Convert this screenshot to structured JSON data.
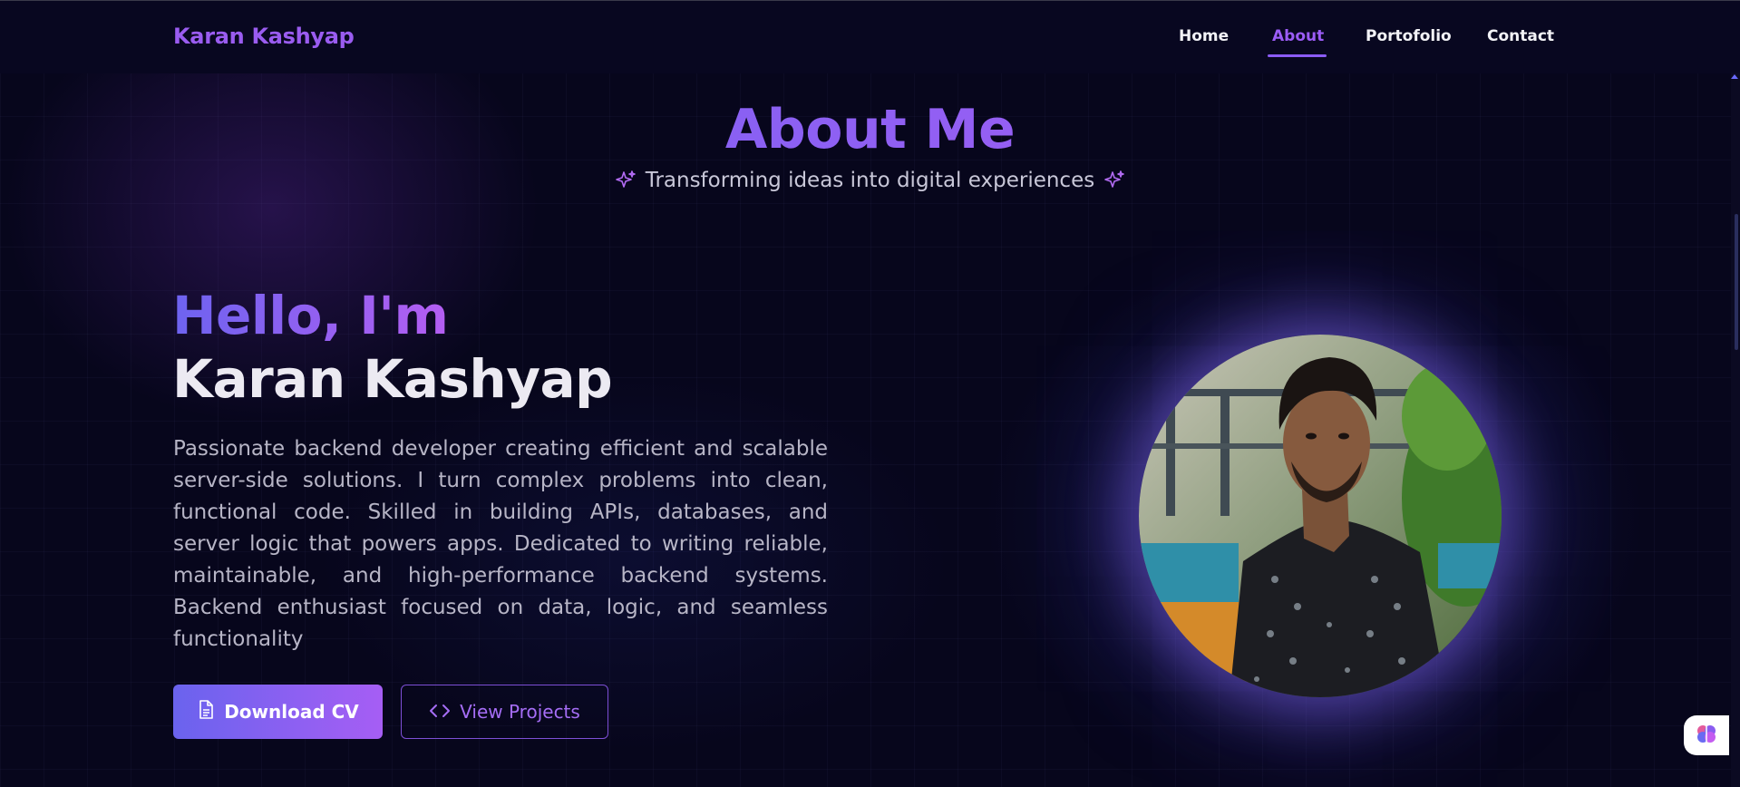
{
  "brand": {
    "name": "Karan Kashyap"
  },
  "nav": {
    "items": [
      {
        "label": "Home"
      },
      {
        "label": "About"
      },
      {
        "label": "Portofolio"
      },
      {
        "label": "Contact"
      }
    ],
    "active": "About"
  },
  "about": {
    "title": "About Me",
    "subtitle": "Transforming ideas into digital experiences"
  },
  "hero": {
    "greeting": "Hello, I'm",
    "name": "Karan Kashyap",
    "bio": "Passionate backend developer creating efficient and scalable server-side solutions. I turn complex problems into clean, functional code. Skilled in building APIs, databases, and server logic that powers apps. Dedicated to writing reliable, maintainable, and high-performance backend systems. Backend enthusiast focused on data, logic, and seamless functionality"
  },
  "buttons": {
    "download_cv": "Download CV",
    "view_projects": "View Projects"
  },
  "icons": {
    "subtitle_left": "sparkles-icon",
    "subtitle_right": "sparkles-icon",
    "download": "document-icon",
    "projects": "code-brackets-icon",
    "widget": "brain-icon"
  },
  "colors": {
    "accent": "#8b5cf6",
    "accent_start": "#6366f1",
    "background": "#07061c",
    "text_muted": "#b7b5c6"
  }
}
